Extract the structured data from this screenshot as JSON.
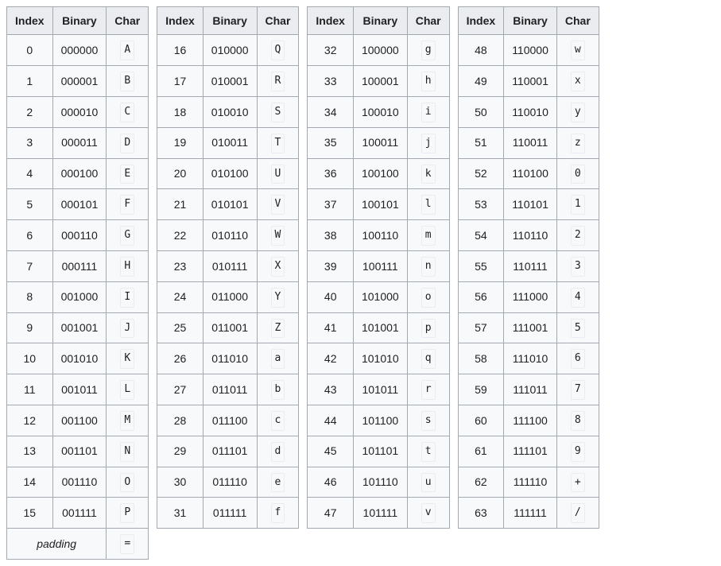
{
  "headers": {
    "index": "Index",
    "binary": "Binary",
    "char": "Char"
  },
  "padding": {
    "label": "padding",
    "char": "="
  },
  "groups": [
    {
      "rows": [
        {
          "index": "0",
          "binary": "000000",
          "char": "A"
        },
        {
          "index": "1",
          "binary": "000001",
          "char": "B"
        },
        {
          "index": "2",
          "binary": "000010",
          "char": "C"
        },
        {
          "index": "3",
          "binary": "000011",
          "char": "D"
        },
        {
          "index": "4",
          "binary": "000100",
          "char": "E"
        },
        {
          "index": "5",
          "binary": "000101",
          "char": "F"
        },
        {
          "index": "6",
          "binary": "000110",
          "char": "G"
        },
        {
          "index": "7",
          "binary": "000111",
          "char": "H"
        },
        {
          "index": "8",
          "binary": "001000",
          "char": "I"
        },
        {
          "index": "9",
          "binary": "001001",
          "char": "J"
        },
        {
          "index": "10",
          "binary": "001010",
          "char": "K"
        },
        {
          "index": "11",
          "binary": "001011",
          "char": "L"
        },
        {
          "index": "12",
          "binary": "001100",
          "char": "M"
        },
        {
          "index": "13",
          "binary": "001101",
          "char": "N"
        },
        {
          "index": "14",
          "binary": "001110",
          "char": "O"
        },
        {
          "index": "15",
          "binary": "001111",
          "char": "P"
        }
      ]
    },
    {
      "rows": [
        {
          "index": "16",
          "binary": "010000",
          "char": "Q"
        },
        {
          "index": "17",
          "binary": "010001",
          "char": "R"
        },
        {
          "index": "18",
          "binary": "010010",
          "char": "S"
        },
        {
          "index": "19",
          "binary": "010011",
          "char": "T"
        },
        {
          "index": "20",
          "binary": "010100",
          "char": "U"
        },
        {
          "index": "21",
          "binary": "010101",
          "char": "V"
        },
        {
          "index": "22",
          "binary": "010110",
          "char": "W"
        },
        {
          "index": "23",
          "binary": "010111",
          "char": "X"
        },
        {
          "index": "24",
          "binary": "011000",
          "char": "Y"
        },
        {
          "index": "25",
          "binary": "011001",
          "char": "Z"
        },
        {
          "index": "26",
          "binary": "011010",
          "char": "a"
        },
        {
          "index": "27",
          "binary": "011011",
          "char": "b"
        },
        {
          "index": "28",
          "binary": "011100",
          "char": "c"
        },
        {
          "index": "29",
          "binary": "011101",
          "char": "d"
        },
        {
          "index": "30",
          "binary": "011110",
          "char": "e"
        },
        {
          "index": "31",
          "binary": "011111",
          "char": "f"
        }
      ]
    },
    {
      "rows": [
        {
          "index": "32",
          "binary": "100000",
          "char": "g"
        },
        {
          "index": "33",
          "binary": "100001",
          "char": "h"
        },
        {
          "index": "34",
          "binary": "100010",
          "char": "i"
        },
        {
          "index": "35",
          "binary": "100011",
          "char": "j"
        },
        {
          "index": "36",
          "binary": "100100",
          "char": "k"
        },
        {
          "index": "37",
          "binary": "100101",
          "char": "l"
        },
        {
          "index": "38",
          "binary": "100110",
          "char": "m"
        },
        {
          "index": "39",
          "binary": "100111",
          "char": "n"
        },
        {
          "index": "40",
          "binary": "101000",
          "char": "o"
        },
        {
          "index": "41",
          "binary": "101001",
          "char": "p"
        },
        {
          "index": "42",
          "binary": "101010",
          "char": "q"
        },
        {
          "index": "43",
          "binary": "101011",
          "char": "r"
        },
        {
          "index": "44",
          "binary": "101100",
          "char": "s"
        },
        {
          "index": "45",
          "binary": "101101",
          "char": "t"
        },
        {
          "index": "46",
          "binary": "101110",
          "char": "u"
        },
        {
          "index": "47",
          "binary": "101111",
          "char": "v"
        }
      ]
    },
    {
      "rows": [
        {
          "index": "48",
          "binary": "110000",
          "char": "w"
        },
        {
          "index": "49",
          "binary": "110001",
          "char": "x"
        },
        {
          "index": "50",
          "binary": "110010",
          "char": "y"
        },
        {
          "index": "51",
          "binary": "110011",
          "char": "z"
        },
        {
          "index": "52",
          "binary": "110100",
          "char": "0"
        },
        {
          "index": "53",
          "binary": "110101",
          "char": "1"
        },
        {
          "index": "54",
          "binary": "110110",
          "char": "2"
        },
        {
          "index": "55",
          "binary": "110111",
          "char": "3"
        },
        {
          "index": "56",
          "binary": "111000",
          "char": "4"
        },
        {
          "index": "57",
          "binary": "111001",
          "char": "5"
        },
        {
          "index": "58",
          "binary": "111010",
          "char": "6"
        },
        {
          "index": "59",
          "binary": "111011",
          "char": "7"
        },
        {
          "index": "60",
          "binary": "111100",
          "char": "8"
        },
        {
          "index": "61",
          "binary": "111101",
          "char": "9"
        },
        {
          "index": "62",
          "binary": "111110",
          "char": "+"
        },
        {
          "index": "63",
          "binary": "111111",
          "char": "/"
        }
      ]
    }
  ]
}
